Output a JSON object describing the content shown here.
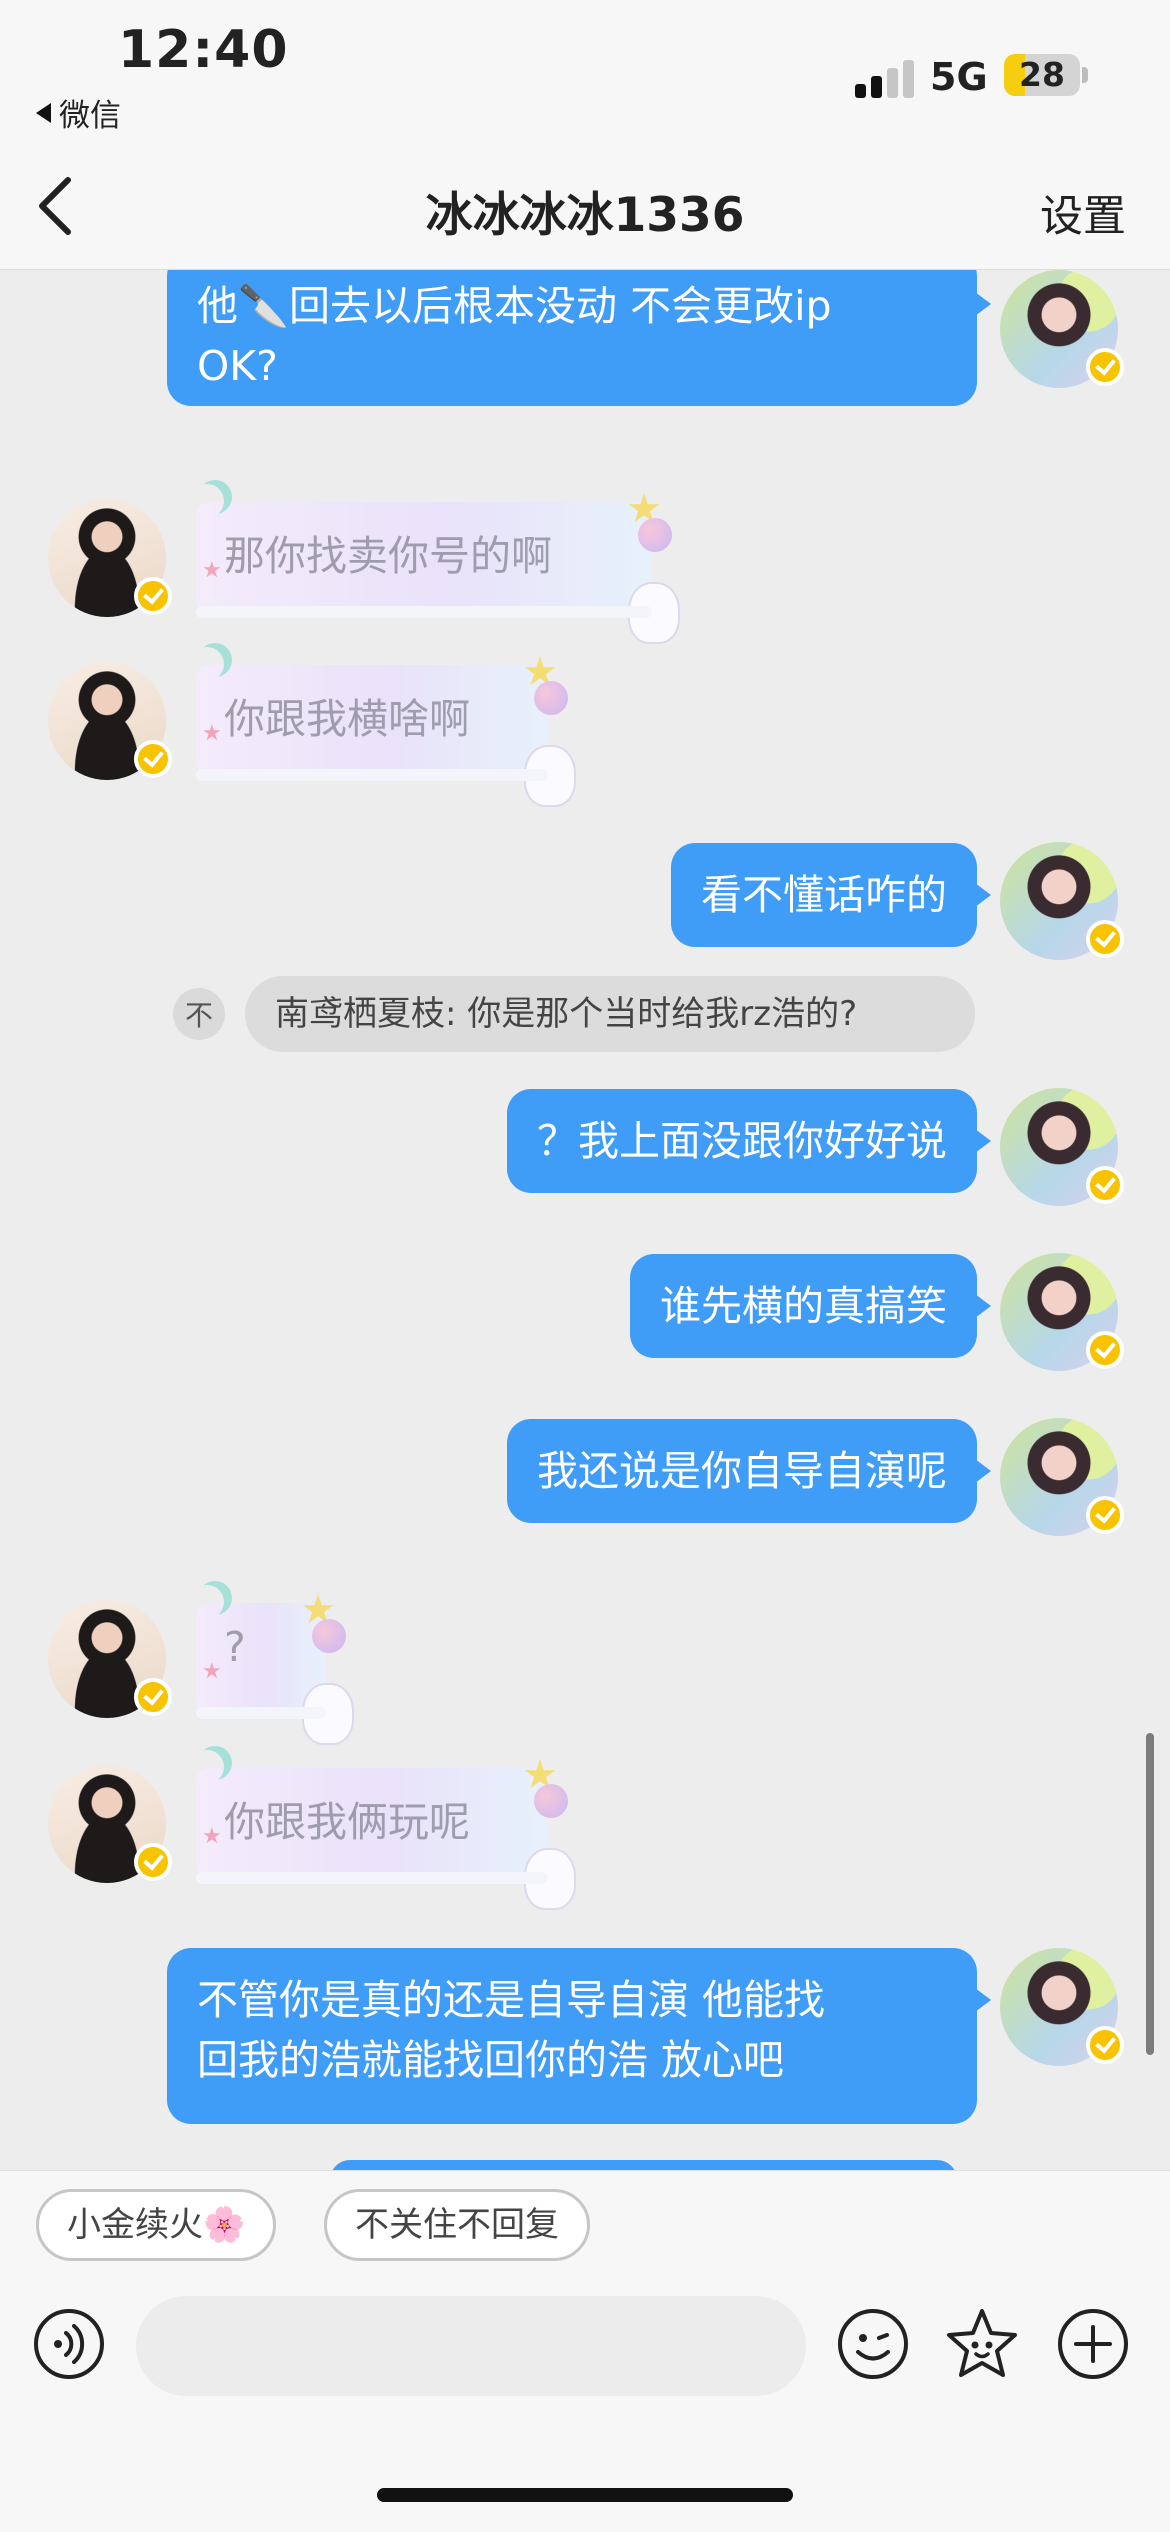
{
  "status_bar": {
    "time": "12:40",
    "back_app": "微信",
    "network": "5G",
    "battery": "28",
    "battery_level": 0.28
  },
  "header": {
    "title": "冰冰冰冰1336",
    "settings": "设置"
  },
  "messages": [
    {
      "side": "out",
      "type": "text",
      "lines": [
        "他🔪回去以后根本没动 不会更改ip",
        "OK?"
      ]
    },
    {
      "side": "in",
      "type": "sticker",
      "text": "那你找卖你号的啊"
    },
    {
      "side": "in",
      "type": "sticker",
      "text": "你跟我横啥啊"
    },
    {
      "side": "out",
      "type": "text",
      "lines": [
        "看不懂话咋的"
      ]
    },
    {
      "side": "system",
      "type": "recall",
      "icon": "不",
      "text": "南鸢栖夏枝: 你是那个当时给我rz浩的?"
    },
    {
      "side": "out",
      "type": "text",
      "lines": [
        "？我上面没跟你好好说"
      ]
    },
    {
      "side": "out",
      "type": "text",
      "lines": [
        "谁先横的真搞笑"
      ]
    },
    {
      "side": "out",
      "type": "text",
      "lines": [
        "我还说是你自导自演呢"
      ]
    },
    {
      "side": "in",
      "type": "sticker",
      "text": "?"
    },
    {
      "side": "in",
      "type": "sticker",
      "text": "你跟我俩玩呢"
    },
    {
      "side": "out",
      "type": "text",
      "lines": [
        "不管你是真的还是自导自演 他能找",
        "回我的浩就能找回你的浩 放心吧"
      ]
    }
  ],
  "quick_replies": [
    "小金续火",
    "不关住不回复"
  ],
  "quick_reply_emoji": "🌸",
  "input": {
    "placeholder": ""
  },
  "icons": [
    "back-icon",
    "voice-icon",
    "emoji-icon",
    "star-face-icon",
    "add-icon"
  ],
  "colors": {
    "bubble_out": "#3f9cf7",
    "badge": "#f8c300",
    "background": "#ededed"
  }
}
